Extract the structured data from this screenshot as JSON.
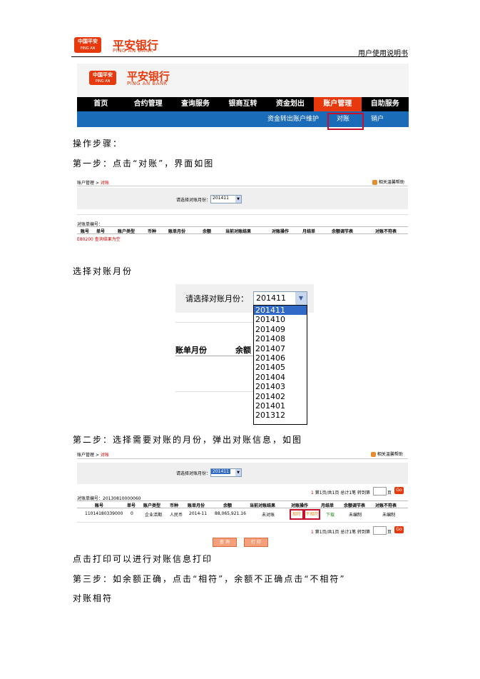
{
  "header": {
    "logo_box_line1": "中国平安",
    "logo_box_line2": "PING AN",
    "bank_cn": "平安银行",
    "bank_en": "PING AN BANK",
    "doc_title": "用户使用说明书"
  },
  "nav": {
    "items": [
      "首页",
      "合约管理",
      "查询服务",
      "银商互转",
      "资金划出",
      "账户管理",
      "自助服务"
    ],
    "active": "账户管理",
    "sub_items": [
      "资金转出账户维护",
      "对账",
      "销户"
    ],
    "sub_selected": "对账"
  },
  "steps": {
    "ops_label": "操作步骤：",
    "step1": "第一步：点击“对账”，界面如图",
    "choose_month": "选择对账月份",
    "step2": "第二步：选择需要对账的月份，弹出对账信息，如图",
    "print_note": "点击打印可以进行对账信息打印",
    "step3": "第三步：如余额正确，点击“相符”，余额不正确点击“不相符”",
    "match_label": "对账相符"
  },
  "shot1": {
    "breadcrumb_a": "账户管理",
    "breadcrumb_b": "对账",
    "help": "相关温馨帮助",
    "month_label": "请选择对账月份：",
    "month_value": "201411",
    "statement_no_label": "对账单编号：",
    "columns": [
      "账号",
      "单号",
      "账户类型",
      "币种",
      "账单月份",
      "余额",
      "当前对账结果",
      "对账操作",
      "月结单",
      "余额调节表",
      "对账不符表"
    ],
    "error": "E80200 查询结果为空"
  },
  "dropdown": {
    "label": "请选择对账月份：",
    "value": "201411",
    "options": [
      "201411",
      "201410",
      "201409",
      "201408",
      "201407",
      "201406",
      "201405",
      "201404",
      "201403",
      "201402",
      "201401",
      "201312"
    ],
    "bg_col1": "账单月份",
    "bg_col2": "余额"
  },
  "shot2": {
    "breadcrumb_a": "账户管理",
    "breadcrumb_b": "对账",
    "help": "相关温馨帮助",
    "month_label": "请选择对账月份：",
    "month_value": "201411",
    "statement_no_label": "对账单编号：",
    "statement_no": "20130810000060",
    "pager_page": "1",
    "pager_text": "第1页/共1页  总计1笔  转到第",
    "pager_unit": "页",
    "go": "Go",
    "columns": [
      "账号",
      "单号",
      "账户类型",
      "币种",
      "账单月份",
      "余额",
      "当前对账结果",
      "对账操作",
      "月结单",
      "余额调节表",
      "对账不符表"
    ],
    "row": [
      "11014180339000",
      "0",
      "企业活期",
      "人民币",
      "2014-11",
      "88,065,921.16",
      "未对账",
      "相符",
      "不相符",
      "下载",
      "未编制",
      "未编制"
    ],
    "btn_view": "查 询",
    "btn_print": "打 印"
  },
  "colors": {
    "brand_orange": "#e8380d",
    "nav_blue": "#1a6bb8",
    "highlight_red": "#c8102e"
  }
}
